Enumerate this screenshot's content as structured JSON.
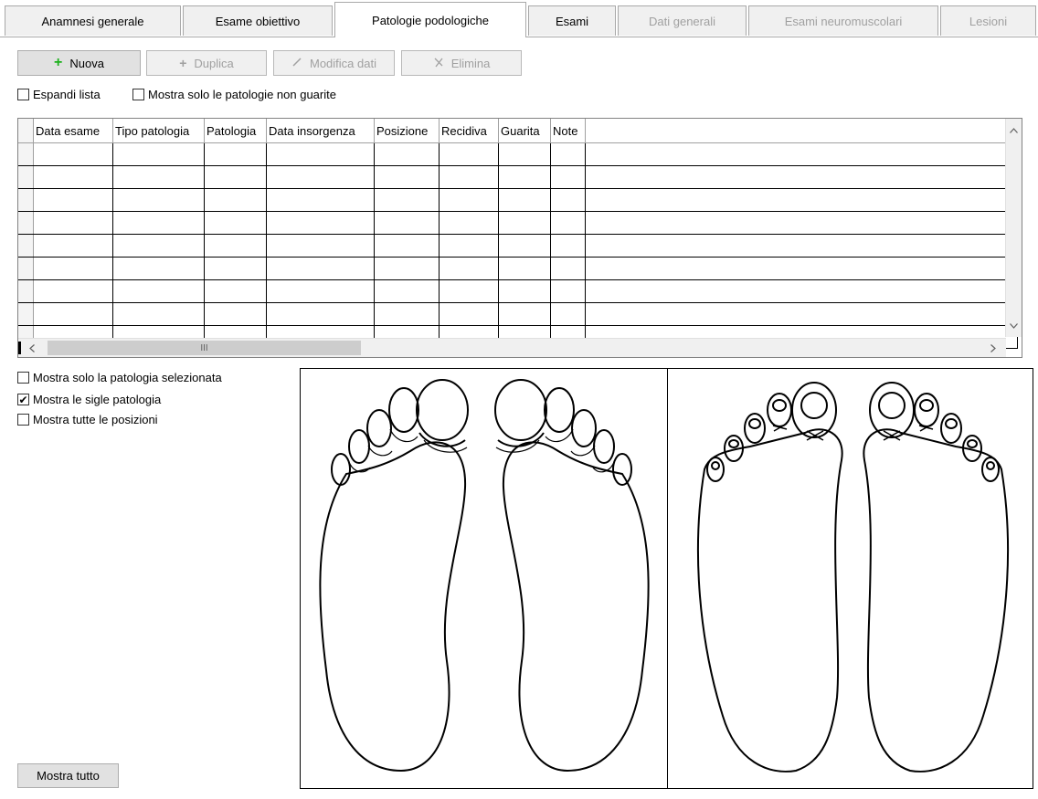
{
  "tabs": [
    {
      "label": "Anamnesi generale",
      "state": "normal"
    },
    {
      "label": "Esame obiettivo",
      "state": "normal"
    },
    {
      "label": "Patologie podologiche",
      "state": "active"
    },
    {
      "label": "Esami",
      "state": "normal"
    },
    {
      "label": "Dati generali",
      "state": "disabled"
    },
    {
      "label": "Esami neuromuscolari",
      "state": "disabled"
    },
    {
      "label": "Lesioni",
      "state": "disabled"
    }
  ],
  "toolbar": {
    "nuova_label": "Nuova",
    "duplica_label": "Duplica",
    "modifica_label": "Modifica dati",
    "elimina_label": "Elimina"
  },
  "filters": {
    "espandi_label": "Espandi lista",
    "espandi_checked": false,
    "non_guarite_label": "Mostra solo le patologie non guarite",
    "non_guarite_checked": false
  },
  "grid": {
    "columns": [
      "Data esame",
      "Tipo patologia",
      "Patologia",
      "Data insorgenza",
      "Posizione",
      "Recidiva",
      "Guarita",
      "Note"
    ],
    "rows": [],
    "scroll_thumb_glyph": "III"
  },
  "options": {
    "selezionata_label": "Mostra solo la patologia selezionata",
    "selezionata_checked": false,
    "sigle_label": "Mostra le sigle patologia",
    "sigle_checked": true,
    "posizioni_label": "Mostra tutte le posizioni",
    "posizioni_checked": false
  },
  "mostra_tutto_label": "Mostra tutto",
  "icons": {
    "nuova": "plus-icon",
    "duplica": "plus-icon",
    "modifica": "pencil-icon",
    "elimina": "x-icon"
  },
  "colors": {
    "accent_green": "#1db11d",
    "disabled_text": "#a0a0a0"
  }
}
